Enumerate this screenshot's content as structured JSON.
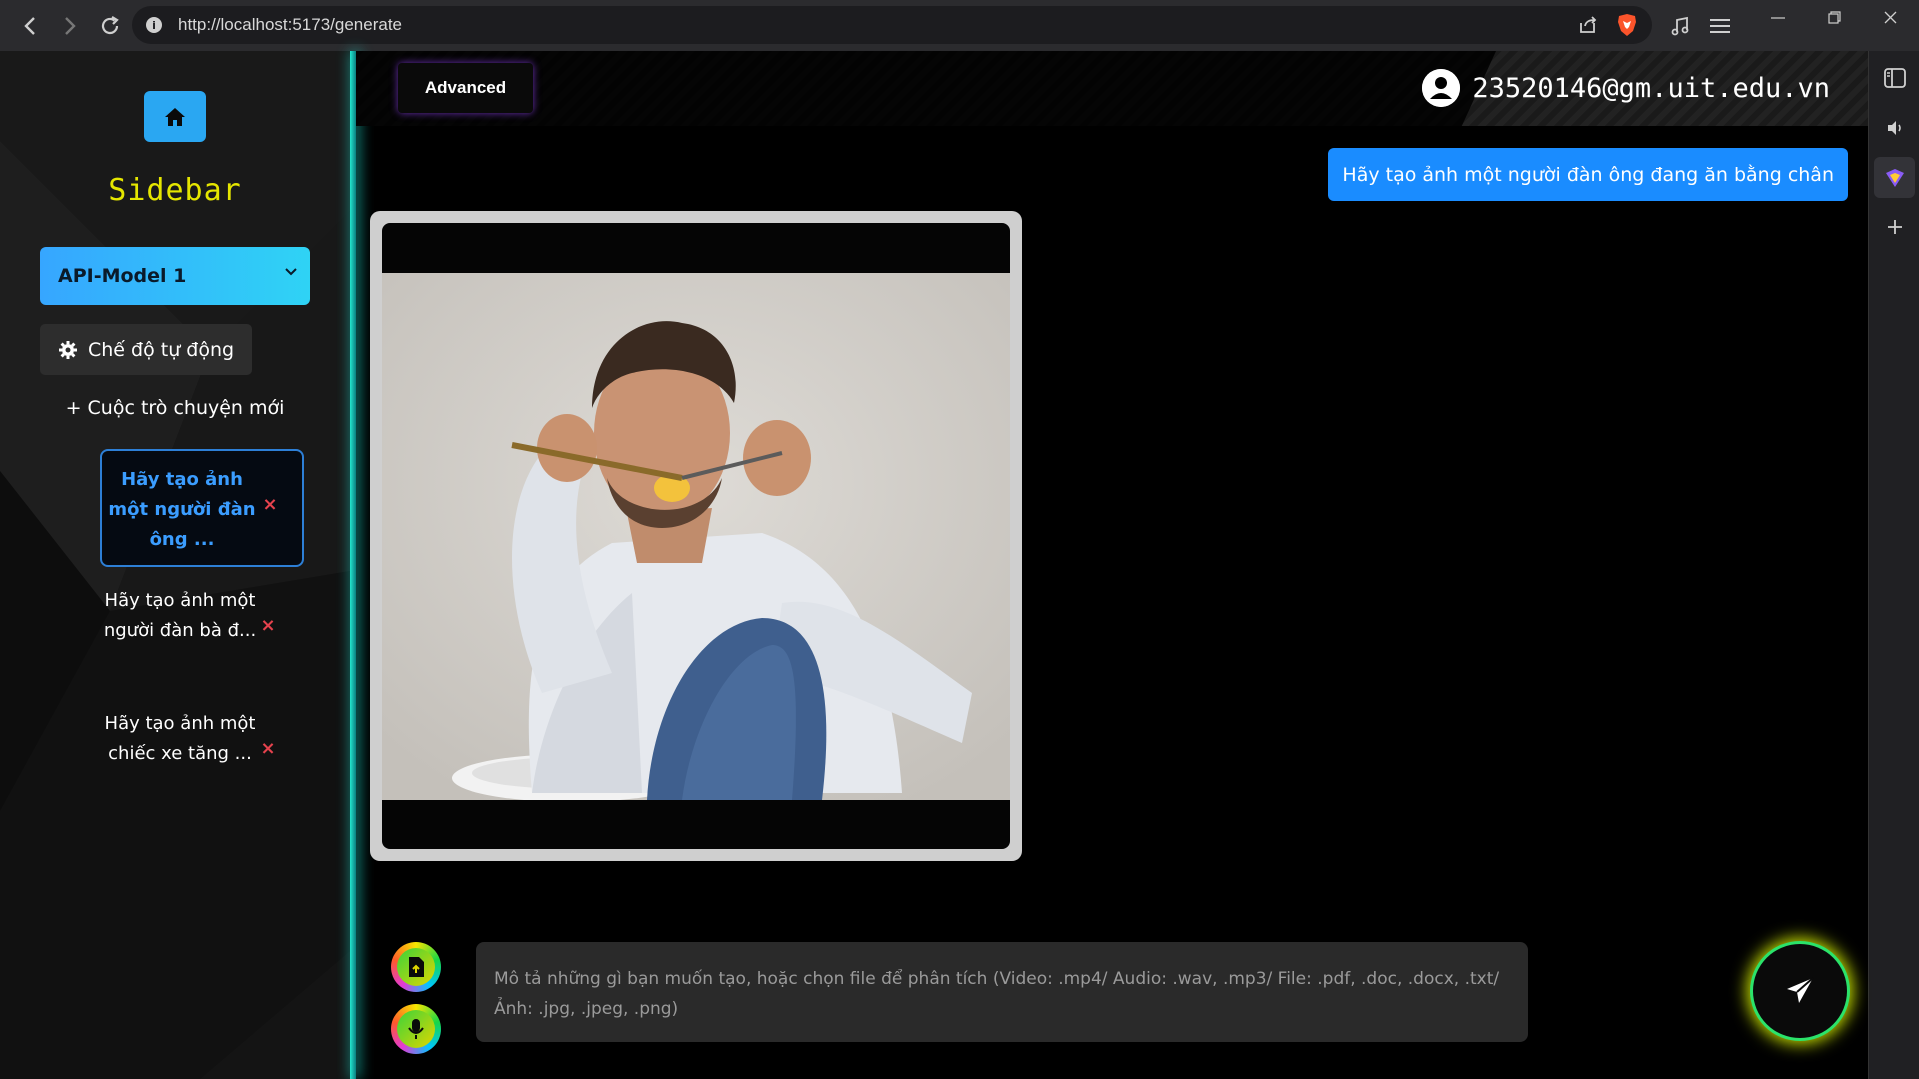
{
  "browser": {
    "url": "http://localhost:5173/generate",
    "icons": [
      "back-icon",
      "forward-icon",
      "reload-icon",
      "info-icon",
      "share-icon",
      "brave-shield-icon",
      "music-icon",
      "menu-icon",
      "minimize-icon",
      "restore-icon",
      "close-icon"
    ],
    "side_icons": [
      "sidebar-panel-icon",
      "volume-icon",
      "vpn-icon",
      "add-icon"
    ]
  },
  "sidebar": {
    "title": "Sidebar",
    "model_select": "API-Model 1",
    "auto_mode_label": "Chế độ tự động",
    "new_chat_label": "+ Cuộc trò chuyện mới",
    "conversations": [
      {
        "label": "Hãy tạo ảnh một người đàn ông ...",
        "active": true
      },
      {
        "label": "Hãy tạo ảnh một người đàn bà đ...",
        "active": false
      },
      {
        "label": "Hãy tạo ảnh một chiếc xe tăng ...",
        "active": false
      }
    ],
    "delete_symbol": "×"
  },
  "header": {
    "advanced_label": "Advanced",
    "user_email": "23520146@gm.uit.edu.vn"
  },
  "chat": {
    "user_message": "Hãy tạo ảnh một người đàn ông đang ăn bằng chân"
  },
  "composer": {
    "placeholder": "Mô tả những gì bạn muốn tạo, hoặc chọn file để phân tích (Video: .mp4/ Audio: .wav, .mp3/ File: .pdf, .doc, .docx, .txt/ Ảnh: .jpg, .jpeg, .png)"
  },
  "colors": {
    "accent": "#2aa7f2",
    "user_bubble": "#1a8cff",
    "sidebar_title": "#e5e600",
    "delete": "#e5424d"
  }
}
